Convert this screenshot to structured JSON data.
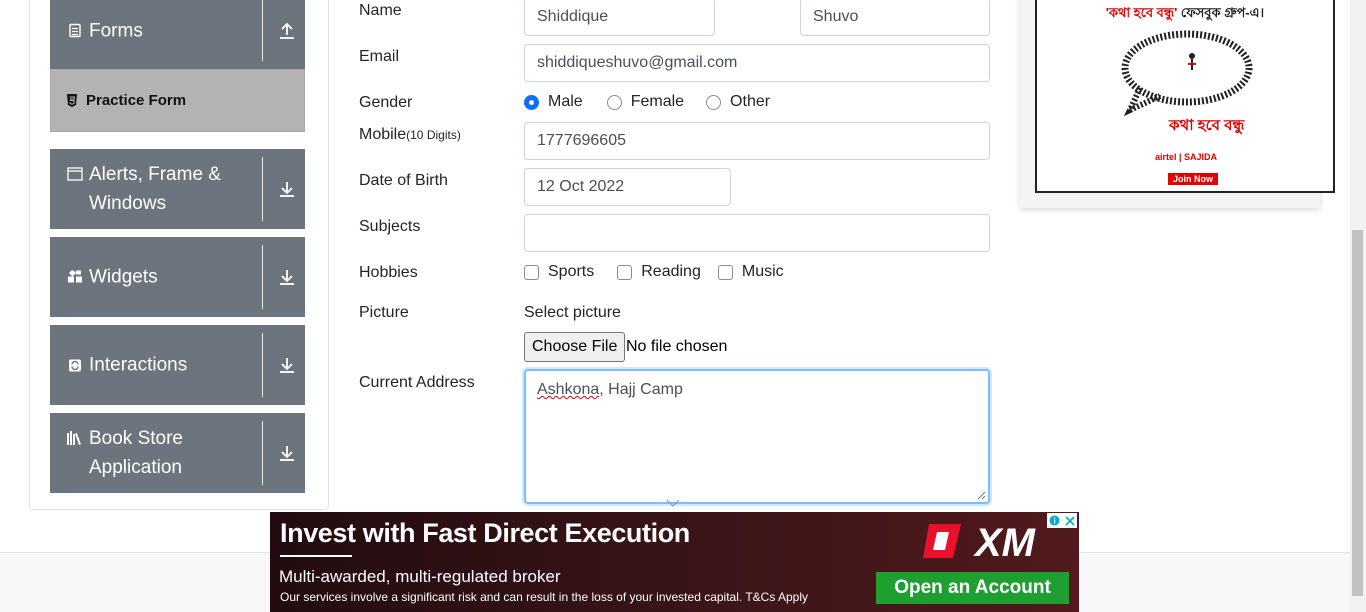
{
  "sidebar": {
    "groups": [
      {
        "label": "Forms",
        "icon": "form-icon",
        "expanded": true
      },
      {
        "label": "Alerts, Frame & Windows",
        "icon": "window-icon",
        "expanded": false
      },
      {
        "label": "Widgets",
        "icon": "widgets-icon",
        "expanded": false
      },
      {
        "label": "Interactions",
        "icon": "interactions-icon",
        "expanded": false
      },
      {
        "label": "Book Store Application",
        "icon": "books-icon",
        "expanded": false
      }
    ],
    "active_item": {
      "label": "Practice Form",
      "icon": "html5-icon"
    }
  },
  "form": {
    "name_label": "Name",
    "first_name": "Shiddique",
    "last_name": "Shuvo",
    "email_label": "Email",
    "email": "shiddiqueshuvo@gmail.com",
    "gender_label": "Gender",
    "gender_options": [
      "Male",
      "Female",
      "Other"
    ],
    "gender_selected": "Male",
    "mobile_label": "Mobile",
    "mobile_hint": "(10 Digits)",
    "mobile": "1777696605",
    "dob_label": "Date of Birth",
    "dob": "12 Oct 2022",
    "subjects_label": "Subjects",
    "subjects": "",
    "hobbies_label": "Hobbies",
    "hobbies": [
      "Sports",
      "Reading",
      "Music"
    ],
    "picture_label": "Picture",
    "picture_prompt": "Select picture",
    "file_button": "Choose File",
    "file_status": "No file chosen",
    "address_label": "Current Address",
    "address_word1": "Ashkona",
    "address_rest": ", Hajj Camp"
  },
  "ad_right": {
    "headline_red": "'কথা হবে বন্ধু'",
    "headline_rest": " ফেসবুক গ্রুপ-এ।",
    "brand": "কথা হবে বন্ধু",
    "partner": "airtel | SAJIDA",
    "cta": "Join Now"
  },
  "ad_bottom": {
    "headline": "Invest with Fast Direct Execution",
    "subline": "Multi-awarded, multi-regulated broker",
    "fine_print": "Our services involve a significant risk and can result in the loss of your invested capital. T&Cs Apply",
    "cta": "Open an Account",
    "logo": "XM",
    "brand_color": "#e8102a",
    "cta_color": "#1f9f32"
  },
  "colors": {
    "sidebar_group": "#6c757d",
    "active_item": "#b3b3b3",
    "radio_checked": "#0d6efd",
    "focus_border": "#80bdff"
  }
}
